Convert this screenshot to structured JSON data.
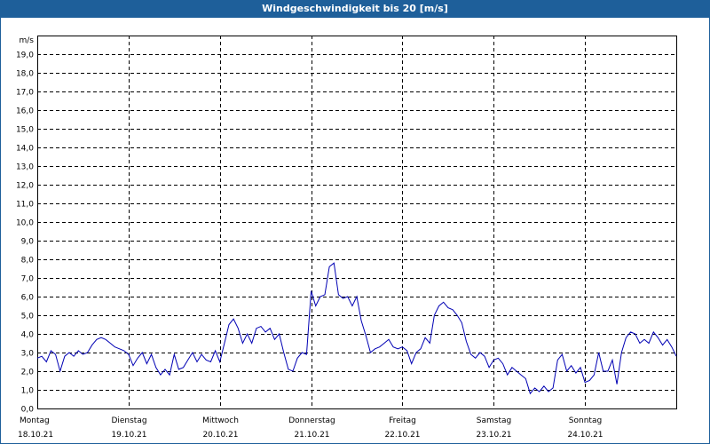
{
  "window": {
    "title": "Windgeschwindigkeit bis 20 [m/s]"
  },
  "chart_data": {
    "type": "line",
    "title": "Windgeschwindigkeit bis 20 [m/s]",
    "ylabel": "m/s",
    "xlabel": "",
    "ylim": [
      0,
      20
    ],
    "ytick_step": 1,
    "ytick_labels": [
      "0,0",
      "1,0",
      "2,0",
      "3,0",
      "4,0",
      "5,0",
      "6,0",
      "7,0",
      "8,0",
      "9,0",
      "10,0",
      "11,0",
      "12,0",
      "13,0",
      "14,0",
      "15,0",
      "16,0",
      "17,0",
      "18,0",
      "19,0"
    ],
    "grid": true,
    "xlim": [
      0,
      7
    ],
    "x_unit": "days since Monday 18.10.21 00:00",
    "x_labels": [
      {
        "day": "Montag",
        "date": "18.10.21"
      },
      {
        "day": "Dienstag",
        "date": "19.10.21"
      },
      {
        "day": "Mittwoch",
        "date": "20.10.21"
      },
      {
        "day": "Donnerstag",
        "date": "21.10.21"
      },
      {
        "day": "Freitag",
        "date": "22.10.21"
      },
      {
        "day": "Samstag",
        "date": "23.10.21"
      },
      {
        "day": "Sonntag",
        "date": "24.10.21"
      }
    ],
    "series": [
      {
        "color": "#0000b4",
        "x": [
          0.0,
          0.05,
          0.1,
          0.15,
          0.2,
          0.25,
          0.3,
          0.35,
          0.4,
          0.45,
          0.5,
          0.55,
          0.6,
          0.65,
          0.7,
          0.75,
          0.8,
          0.85,
          0.9,
          0.95,
          1.0,
          1.05,
          1.1,
          1.15,
          1.2,
          1.25,
          1.3,
          1.35,
          1.4,
          1.45,
          1.5,
          1.55,
          1.6,
          1.65,
          1.7,
          1.75,
          1.8,
          1.85,
          1.9,
          1.95,
          2.0,
          2.05,
          2.1,
          2.15,
          2.2,
          2.25,
          2.3,
          2.35,
          2.4,
          2.45,
          2.5,
          2.55,
          2.6,
          2.65,
          2.7,
          2.75,
          2.8,
          2.85,
          2.9,
          2.95,
          3.0,
          3.05,
          3.1,
          3.15,
          3.2,
          3.25,
          3.3,
          3.35,
          3.4,
          3.45,
          3.5,
          3.55,
          3.6,
          3.65,
          3.7,
          3.75,
          3.8,
          3.85,
          3.9,
          3.95,
          4.0,
          4.05,
          4.1,
          4.15,
          4.2,
          4.25,
          4.3,
          4.35,
          4.4,
          4.45,
          4.5,
          4.55,
          4.6,
          4.65,
          4.7,
          4.75,
          4.8,
          4.85,
          4.9,
          4.95,
          5.0,
          5.05,
          5.1,
          5.15,
          5.2,
          5.25,
          5.3,
          5.35,
          5.4,
          5.45,
          5.5,
          5.55,
          5.6,
          5.65,
          5.7,
          5.75,
          5.8,
          5.85,
          5.9,
          5.95,
          6.0,
          6.05,
          6.1,
          6.15,
          6.2,
          6.25,
          6.3,
          6.35,
          6.4,
          6.45,
          6.5,
          6.55,
          6.6,
          6.65,
          6.7,
          6.75,
          6.8,
          6.85,
          6.9,
          6.95,
          7.0
        ],
        "values": [
          2.7,
          2.8,
          2.5,
          3.1,
          2.9,
          2.0,
          2.8,
          3.0,
          2.8,
          3.1,
          2.9,
          3.0,
          3.4,
          3.7,
          3.8,
          3.7,
          3.5,
          3.3,
          3.2,
          3.1,
          2.9,
          2.3,
          2.7,
          3.0,
          2.4,
          2.9,
          2.2,
          1.8,
          2.1,
          1.8,
          2.9,
          2.1,
          2.2,
          2.6,
          3.0,
          2.5,
          2.9,
          2.6,
          2.5,
          3.1,
          2.5,
          3.5,
          4.5,
          4.8,
          4.3,
          3.5,
          4.0,
          3.5,
          4.3,
          4.4,
          4.1,
          4.3,
          3.7,
          4.0,
          3.0,
          2.1,
          2.0,
          2.7,
          3.0,
          2.9,
          6.3,
          5.5,
          6.0,
          6.1,
          7.6,
          7.8,
          6.1,
          5.9,
          6.0,
          5.5,
          6.0,
          4.7,
          3.9,
          3.0,
          3.2,
          3.3,
          3.5,
          3.7,
          3.3,
          3.2,
          3.3,
          3.1,
          2.4,
          3.0,
          3.2,
          3.8,
          3.5,
          5.0,
          5.5,
          5.7,
          5.4,
          5.3,
          5.0,
          4.6,
          3.6,
          2.9,
          2.7,
          3.0,
          2.8,
          2.2,
          2.6,
          2.7,
          2.4,
          1.8,
          2.2,
          2.0,
          1.8,
          1.6,
          0.8,
          1.1,
          0.9,
          1.2,
          0.9,
          1.1,
          2.6,
          2.9,
          2.0,
          2.3,
          1.9,
          2.2,
          1.4,
          1.5,
          1.8,
          3.0,
          2.0,
          2.0,
          2.6,
          1.3,
          3.0,
          3.8,
          4.1,
          4.0,
          3.5,
          3.7,
          3.5,
          4.1,
          3.8,
          3.4,
          3.7,
          3.3,
          2.8
        ]
      }
    ]
  }
}
